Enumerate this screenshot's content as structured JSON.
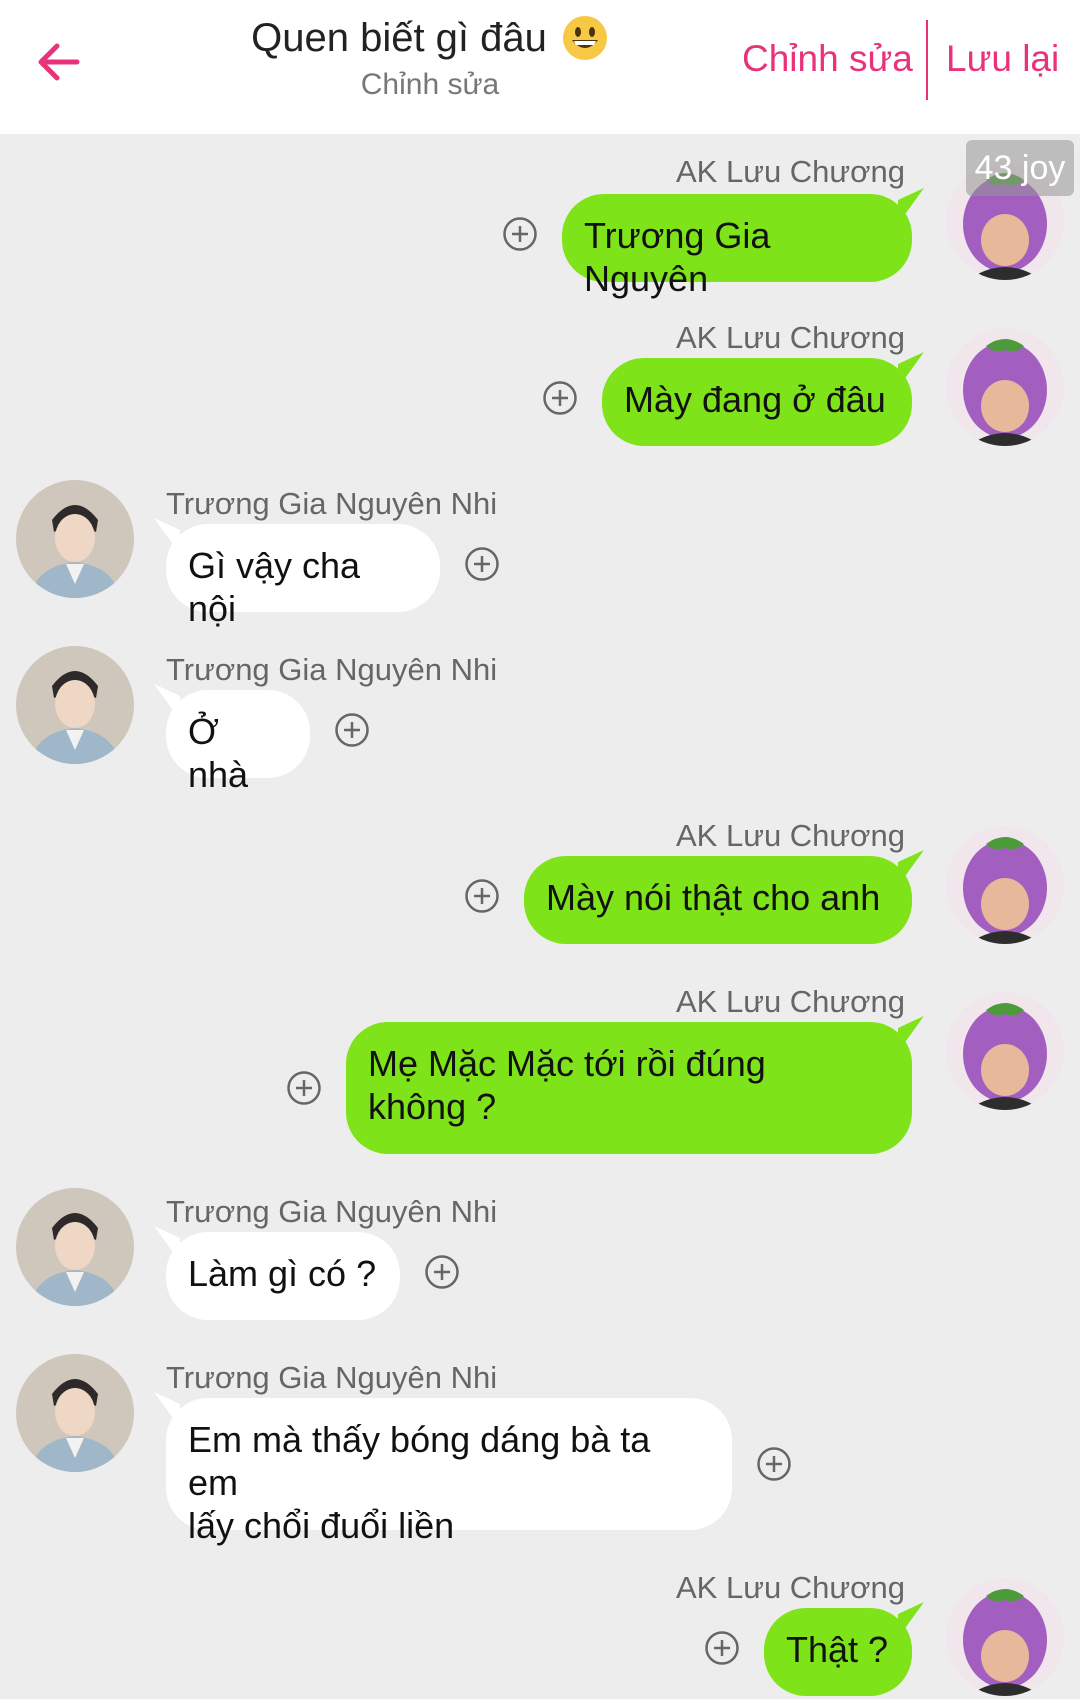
{
  "header": {
    "title": "Quen biết gì đâu",
    "subtitle": "Chỉnh sửa",
    "edit_label": "Chỉnh sửa",
    "save_label": "Lưu lại",
    "accent_color": "#e8337a"
  },
  "overlay": {
    "badge": "43 joy"
  },
  "messages": [
    {
      "sender": "AK Lưu Chương",
      "side": "right",
      "text": "Trương Gia Nguyên"
    },
    {
      "sender": "AK Lưu Chương",
      "side": "right",
      "text": "Mày đang ở đâu"
    },
    {
      "sender": "Trương Gia Nguyên Nhi",
      "side": "left",
      "text": "Gì vậy cha nội"
    },
    {
      "sender": "Trương Gia Nguyên Nhi",
      "side": "left",
      "text": "Ở nhà"
    },
    {
      "sender": "AK Lưu Chương",
      "side": "right",
      "text": "Mày nói thật cho anh"
    },
    {
      "sender": "AK Lưu Chương",
      "side": "right",
      "text_line1": "Mẹ Mặc Mặc tới rồi đúng",
      "text_line2": "không ?"
    },
    {
      "sender": "Trương Gia Nguyên Nhi",
      "side": "left",
      "text": "Làm gì có ?"
    },
    {
      "sender": "Trương Gia Nguyên Nhi",
      "side": "left",
      "text_line1": "Em mà thấy bóng dáng bà ta em",
      "text_line2": "lấy chổi đuổi liền"
    },
    {
      "sender": "AK Lưu Chương",
      "side": "right",
      "text": "Thật ?"
    }
  ],
  "colors": {
    "right_bubble": "#7ee319",
    "left_bubble": "#ffffff",
    "background": "#ededed"
  },
  "icons": {
    "back": "arrow-left-icon",
    "add": "plus-circle-icon",
    "emoji": "grinning-face-icon"
  }
}
